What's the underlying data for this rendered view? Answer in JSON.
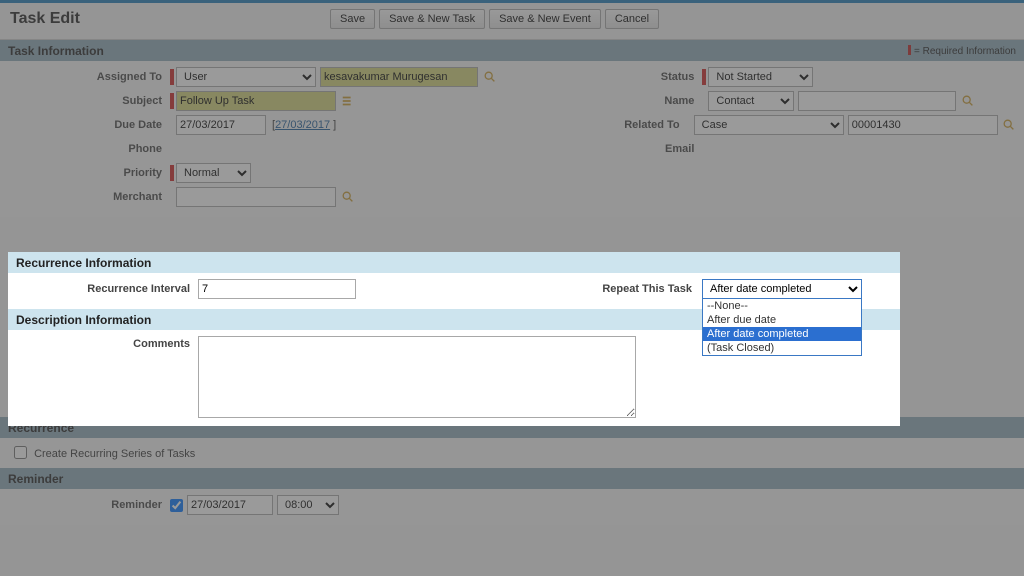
{
  "page": {
    "title": "Task Edit",
    "req_note": "= Required Information"
  },
  "buttons": {
    "save": "Save",
    "save_new_task": "Save & New Task",
    "save_new_event": "Save & New Event",
    "cancel": "Cancel"
  },
  "sections": {
    "task_info": "Task Information",
    "recurrence_info": "Recurrence Information",
    "description_info": "Description Information",
    "recurrence": "Recurrence",
    "reminder": "Reminder"
  },
  "labels": {
    "assigned_to": "Assigned To",
    "subject": "Subject",
    "due_date": "Due Date",
    "phone": "Phone",
    "priority": "Priority",
    "merchant": "Merchant",
    "status": "Status",
    "name": "Name",
    "related_to": "Related To",
    "email": "Email",
    "recurrence_interval": "Recurrence Interval",
    "repeat_this_task": "Repeat This Task",
    "comments": "Comments",
    "create_series": "Create Recurring Series of Tasks",
    "reminder": "Reminder"
  },
  "fields": {
    "assigned_type": "User",
    "assigned_to": "kesavakumar Murugesan",
    "subject": "Follow Up Task",
    "due_date": "27/03/2017",
    "due_date_link": "27/03/2017",
    "priority": "Normal",
    "merchant": "",
    "status": "Not Started",
    "name_type": "Contact",
    "name_value": "",
    "related_type": "Case",
    "related_value": "00001430",
    "recurrence_interval": "7",
    "repeat_selected": "After date completed",
    "repeat_options": {
      "none": "--None--",
      "after_due": "After due date",
      "after_completed": "After date completed",
      "task_closed": "(Task Closed)"
    },
    "comments": "",
    "create_series": false,
    "reminder_checked": true,
    "reminder_date": "27/03/2017",
    "reminder_time": "08:00"
  }
}
